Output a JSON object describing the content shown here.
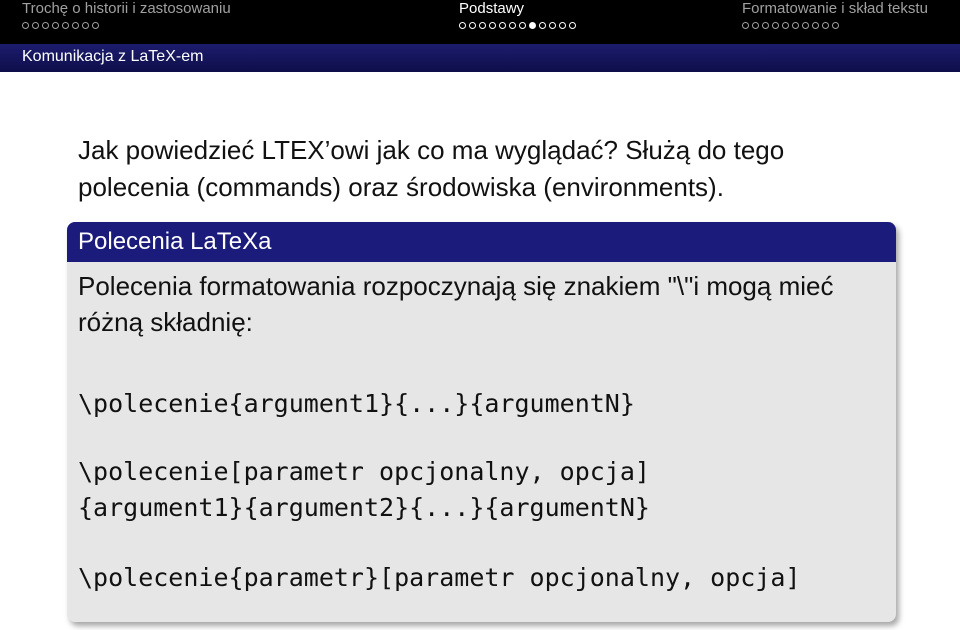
{
  "nav": {
    "sections": [
      {
        "label": "Trochę o historii i zastosowaniu",
        "dots": 8,
        "current": -1
      },
      {
        "label": "Podstawy",
        "dots": 12,
        "current": 7
      },
      {
        "label": "Formatowanie i skład tekstu",
        "dots": 10,
        "current": -1
      }
    ],
    "subsection": "Komunikacja z LaTeX-em"
  },
  "intro": "Jak powiedzieć LTEX’owi jak co ma wyglądać? Służą do tego polecenia (commands) oraz środowiska (environments).",
  "block": {
    "title": "Polecenia LaTeXa",
    "text": "Polecenia formatowania rozpoczynają się znakiem \"\\\"i mogą mieć różną składnię:",
    "code": [
      "\\polecenie{argument1}{...}{argumentN}",
      "\\polecenie[parametr opcjonalny, opcja]",
      "{argument1}{argument2}{...}{argumentN}",
      "\\polecenie{parametr}[parametr opcjonalny, opcja]"
    ]
  },
  "colors": {
    "topbar": "#000000",
    "subbar": "#1b1b7c",
    "block_title": "#1b1b7c",
    "block_body": "#e6e6e6"
  }
}
